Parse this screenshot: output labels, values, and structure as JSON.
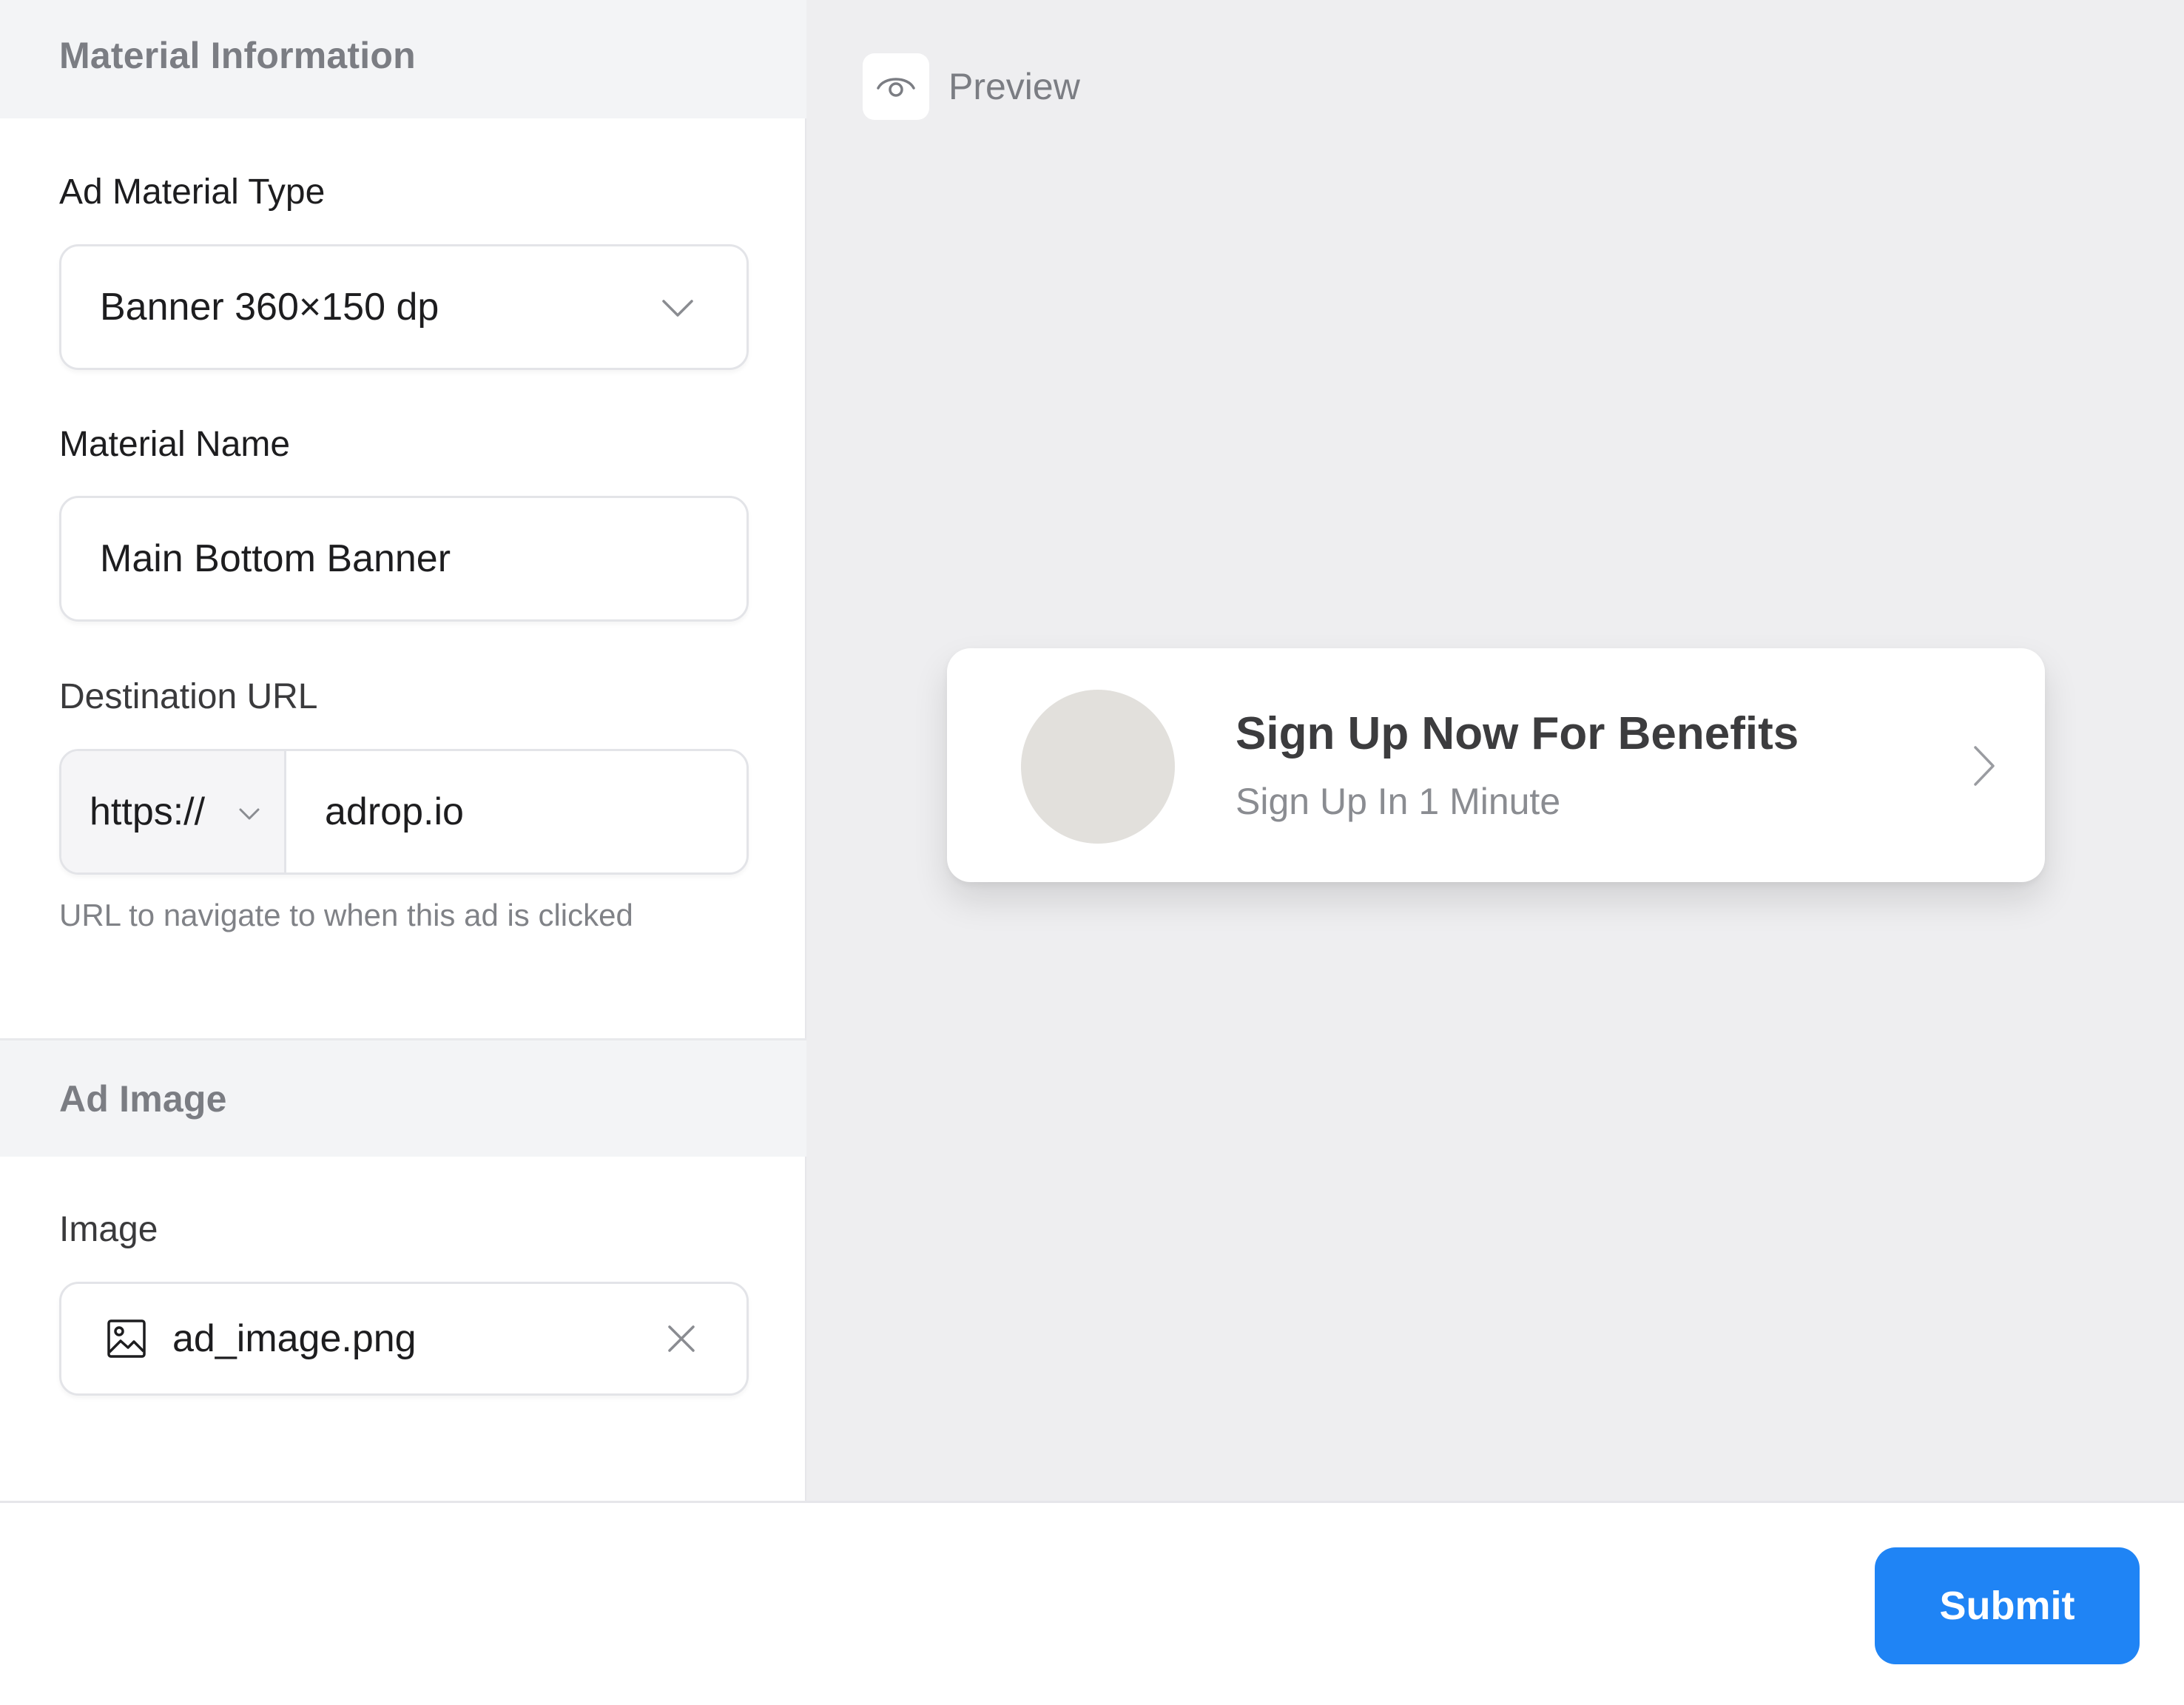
{
  "sections": {
    "material_info_title": "Material Information",
    "ad_image_title": "Ad Image"
  },
  "fields": {
    "ad_material_type": {
      "label": "Ad Material Type",
      "value": "Banner 360×150 dp"
    },
    "material_name": {
      "label": "Material Name",
      "value": "Main Bottom Banner"
    },
    "destination_url": {
      "label": "Destination URL",
      "protocol": "https://",
      "value": "adrop.io",
      "helper": "URL to navigate to when this ad is clicked"
    },
    "image": {
      "label": "Image",
      "file_name": "ad_image.png"
    }
  },
  "preview": {
    "label": "Preview",
    "icon": "eye-icon",
    "banner": {
      "title": "Sign Up Now For Benefits",
      "subtitle": "Sign Up In 1 Minute"
    }
  },
  "footer": {
    "submit_label": "Submit"
  },
  "colors": {
    "accent": "#1f84f5",
    "preview_bg": "#eeeef0",
    "section_header_bg": "#f3f4f6",
    "avatar_placeholder": "#e2e0dc"
  }
}
